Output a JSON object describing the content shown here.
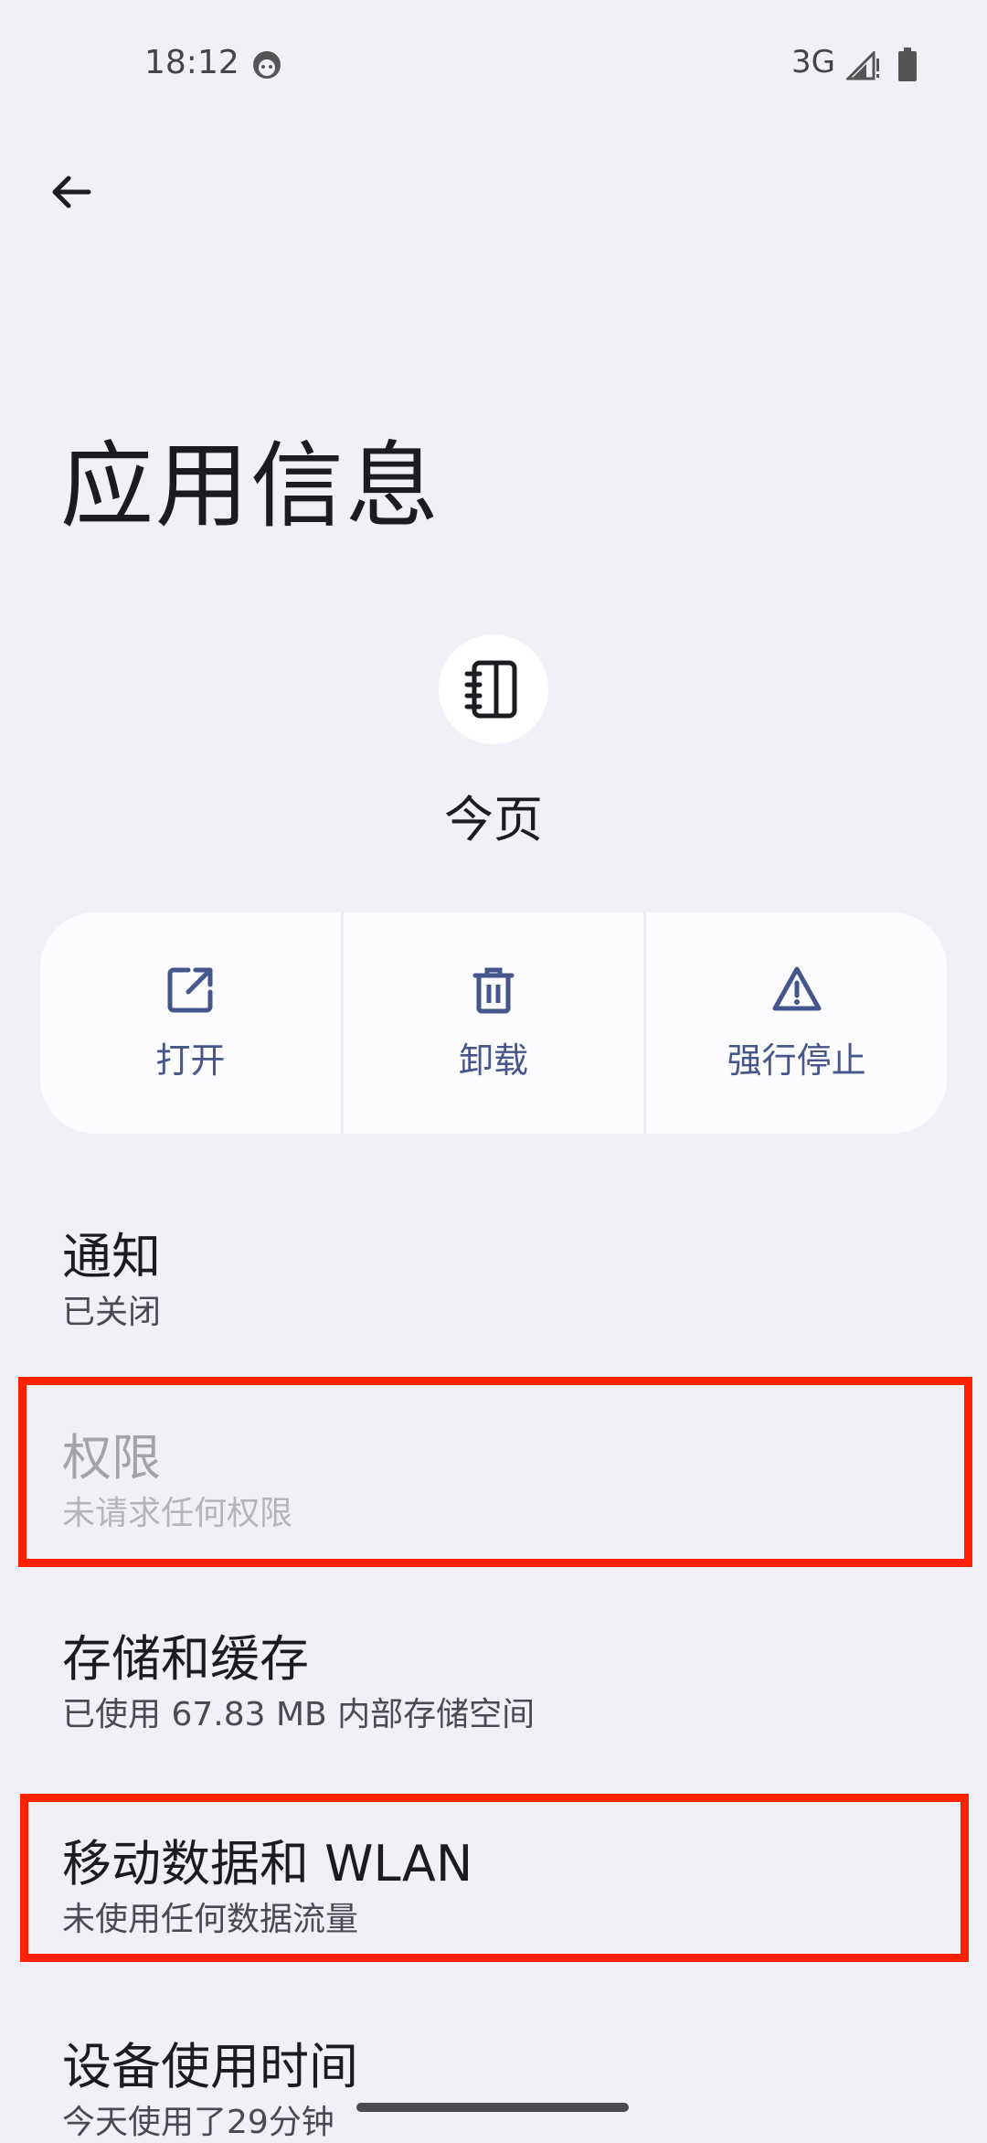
{
  "status_bar": {
    "time": "18:12",
    "network": "3G"
  },
  "header": {
    "title": "应用信息"
  },
  "app": {
    "name": "今页"
  },
  "actions": [
    {
      "label": "打开",
      "icon": "open-external-icon"
    },
    {
      "label": "卸载",
      "icon": "trash-icon"
    },
    {
      "label": "强行停止",
      "icon": "warning-icon"
    }
  ],
  "list": {
    "notification": {
      "title": "通知",
      "subtitle": "已关闭"
    },
    "permissions": {
      "title": "权限",
      "subtitle": "未请求任何权限"
    },
    "storage": {
      "title": "存储和缓存",
      "subtitle": "已使用 67.83 MB 内部存储空间"
    },
    "mobile_data": {
      "title": "移动数据和 WLAN",
      "subtitle": "未使用任何数据流量"
    },
    "screen_time": {
      "title": "设备使用时间",
      "subtitle": "今天使用了29分钟"
    }
  },
  "colors": {
    "background": "#f1f0f6",
    "accent": "#45568a",
    "highlight": "#ff2200"
  }
}
